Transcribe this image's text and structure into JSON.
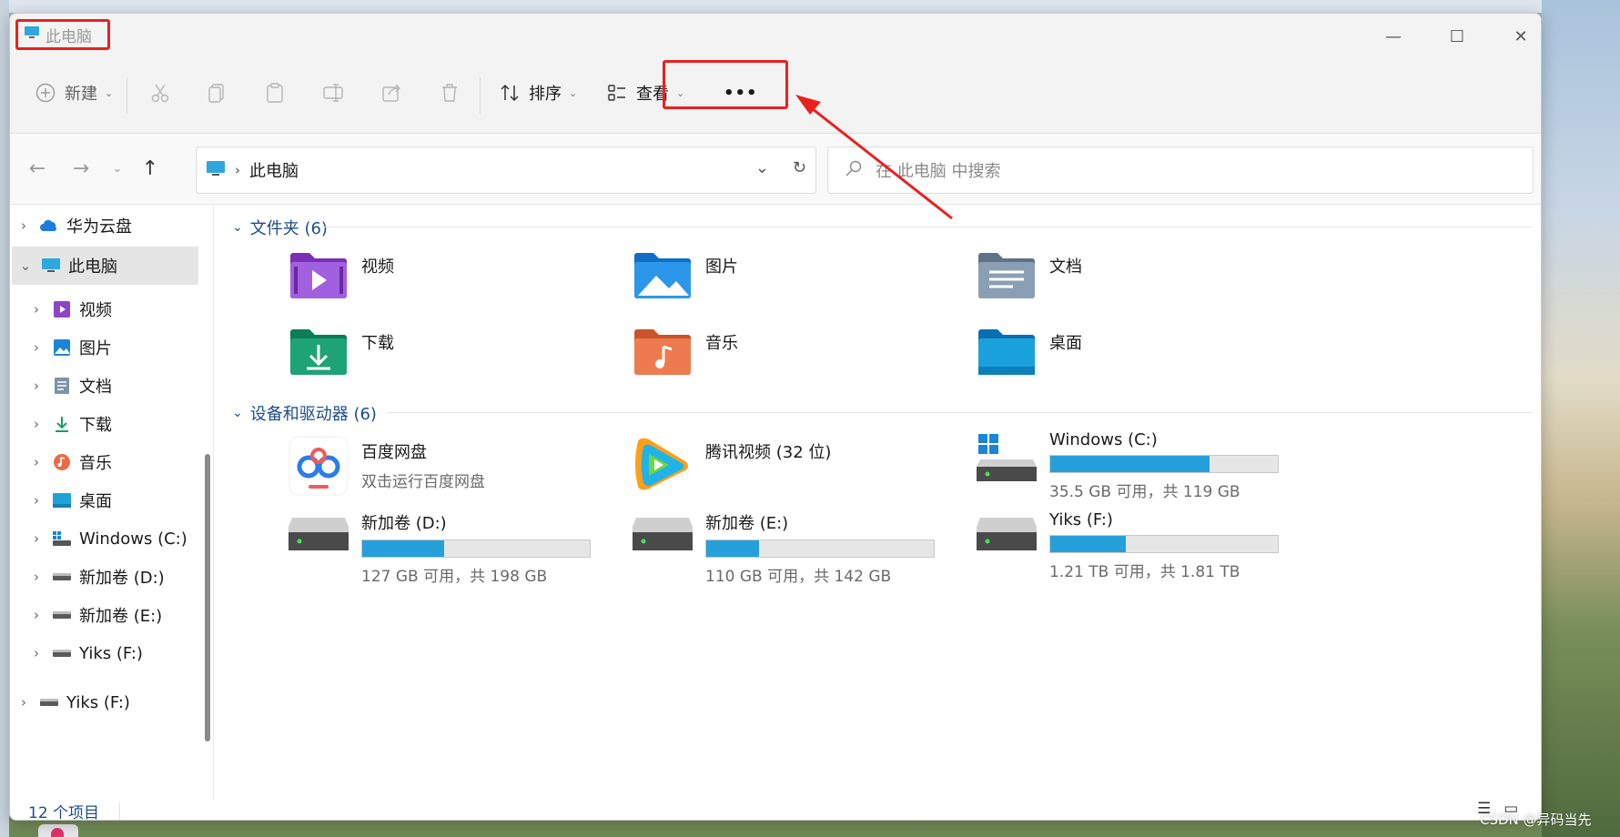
{
  "window": {
    "title": "此电脑",
    "controls": {
      "minimize": "—",
      "maximize": "☐",
      "close": "✕"
    }
  },
  "toolbar": {
    "new_label": "新建",
    "sort_label": "排序",
    "view_label": "查看",
    "more_label": "•••"
  },
  "address": {
    "path_separator": "›",
    "path": "此电脑",
    "search_placeholder": "在 此电脑 中搜索"
  },
  "sidebar": {
    "items": [
      {
        "label": "华为云盘",
        "icon": "cloud-icon"
      },
      {
        "label": "此电脑",
        "icon": "pc-icon",
        "selected": true
      },
      {
        "label": "视频",
        "icon": "video-icon"
      },
      {
        "label": "图片",
        "icon": "pictures-icon"
      },
      {
        "label": "文档",
        "icon": "documents-icon"
      },
      {
        "label": "下载",
        "icon": "download-icon"
      },
      {
        "label": "音乐",
        "icon": "music-icon"
      },
      {
        "label": "桌面",
        "icon": "desktop-icon"
      },
      {
        "label": "Windows (C:)",
        "icon": "windows-drive-icon"
      },
      {
        "label": "新加卷 (D:)",
        "icon": "drive-icon"
      },
      {
        "label": "新加卷 (E:)",
        "icon": "drive-icon"
      },
      {
        "label": "Yiks (F:)",
        "icon": "drive-icon"
      },
      {
        "label": "Yiks (F:)",
        "icon": "drive-icon"
      }
    ]
  },
  "main": {
    "folders_header": "文件夹 (6)",
    "folders": [
      {
        "label": "视频",
        "icon": "video-folder-icon"
      },
      {
        "label": "图片",
        "icon": "pictures-folder-icon"
      },
      {
        "label": "文档",
        "icon": "documents-folder-icon"
      },
      {
        "label": "下载",
        "icon": "download-folder-icon"
      },
      {
        "label": "音乐",
        "icon": "music-folder-icon"
      },
      {
        "label": "桌面",
        "icon": "desktop-folder-icon"
      }
    ],
    "devices_header": "设备和驱动器 (6)",
    "devices": [
      {
        "label": "百度网盘",
        "sub": "双击运行百度网盘",
        "icon": "baidu-netdisk-icon"
      },
      {
        "label": "腾讯视频 (32 位)",
        "sub": "",
        "icon": "tencent-video-icon"
      },
      {
        "label": "Windows (C:)",
        "sub": "35.5 GB 可用，共 119 GB",
        "used_fraction": 0.7,
        "icon": "windows-drive-icon"
      },
      {
        "label": "新加卷 (D:)",
        "sub": "127 GB 可用，共 198 GB",
        "used_fraction": 0.36,
        "icon": "drive-icon"
      },
      {
        "label": "新加卷 (E:)",
        "sub": "110 GB 可用，共 142 GB",
        "used_fraction": 0.23,
        "icon": "drive-icon"
      },
      {
        "label": "Yiks (F:)",
        "sub": "1.21 TB 可用，共 1.81 TB",
        "used_fraction": 0.33,
        "icon": "drive-icon"
      }
    ]
  },
  "status": {
    "item_count": "12 个项目"
  },
  "watermark": "CSDN @异码当先",
  "colors": {
    "accent": "#26a0da",
    "highlight": "#e8211f",
    "group_header": "#1c4e8a"
  }
}
